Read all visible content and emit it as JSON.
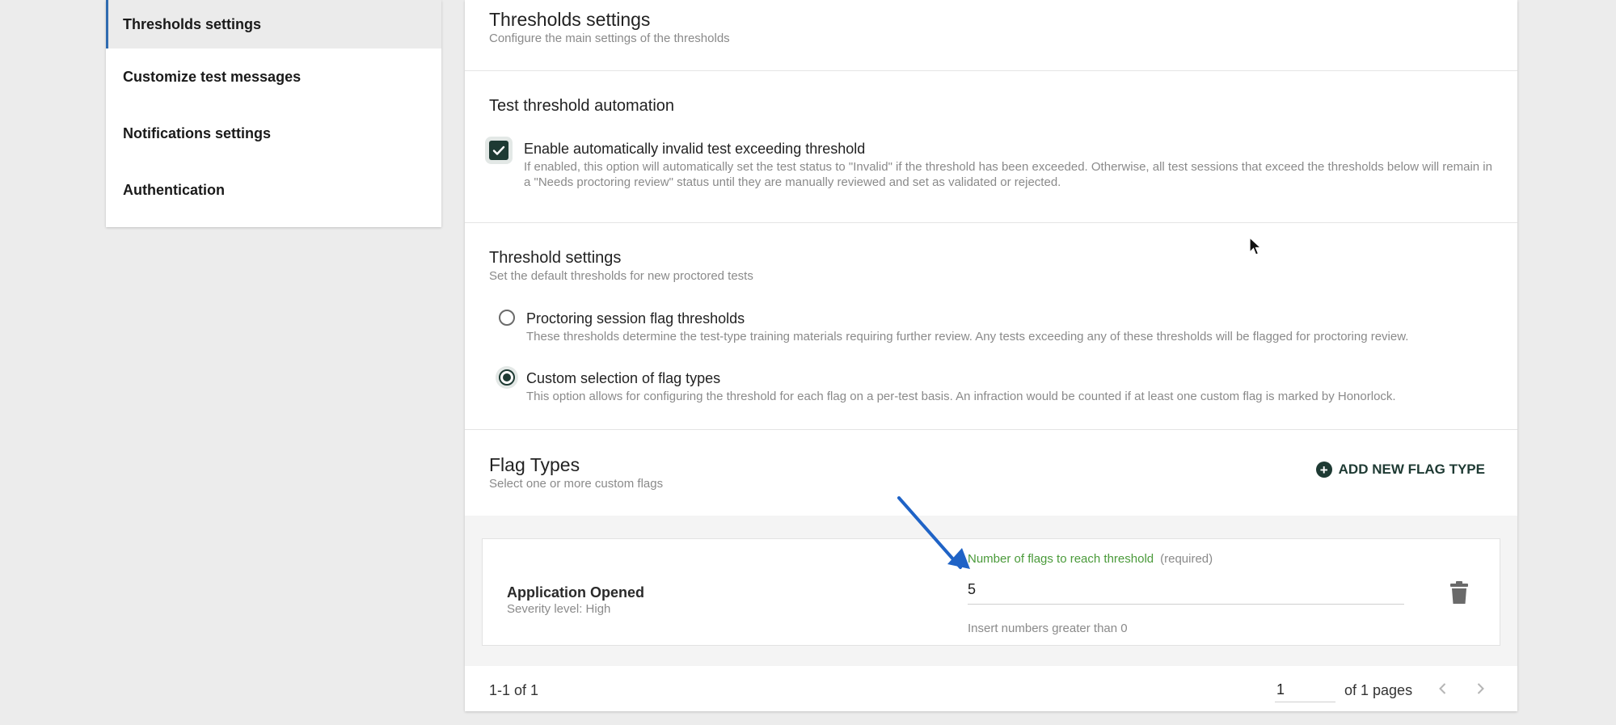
{
  "sidebar": {
    "items": [
      {
        "label": "Thresholds settings",
        "active": true
      },
      {
        "label": "Customize test messages"
      },
      {
        "label": "Notifications settings"
      },
      {
        "label": "Authentication"
      }
    ]
  },
  "header": {
    "title": "Thresholds settings",
    "subtitle": "Configure the main settings of the thresholds"
  },
  "automation": {
    "title": "Test threshold automation",
    "checkbox_label": "Enable automatically invalid test exceeding threshold",
    "checkbox_desc": "If enabled, this option will automatically set the test status to \"Invalid\" if the threshold has been exceeded. Otherwise, all test sessions that exceed the thresholds below will remain in a \"Needs proctoring review\" status until they are manually reviewed and set as validated or rejected.",
    "checked": true
  },
  "threshold": {
    "title": "Threshold settings",
    "subtitle": "Set the default thresholds for new proctored tests",
    "options": [
      {
        "label": "Proctoring session flag thresholds",
        "desc": "These thresholds determine the test-type training materials requiring further review. Any tests exceeding any of these thresholds will be flagged for proctoring review.",
        "selected": false
      },
      {
        "label": "Custom selection of flag types",
        "desc": "This option allows for configuring the threshold for each flag on a per-test basis. An infraction would be counted if at least one custom flag is marked by Honorlock.",
        "selected": true
      }
    ]
  },
  "flag_types": {
    "title": "Flag Types",
    "subtitle": "Select one or more custom flags",
    "add_label": "ADD NEW FLAG TYPE",
    "items": [
      {
        "name": "Application Opened",
        "severity": "Severity level: High",
        "field_label": "Number of flags to reach threshold",
        "field_required": "(required)",
        "value": "5",
        "hint": "Insert numbers greater than 0"
      }
    ]
  },
  "pagination": {
    "range": "1-1 of 1",
    "page": "1",
    "of_pages": "of 1 pages"
  },
  "colors": {
    "accent": "#1e3a33",
    "active_indicator": "#2f6bb0",
    "label_green": "#4a9a3a",
    "annotation_arrow": "#1f63c6"
  }
}
